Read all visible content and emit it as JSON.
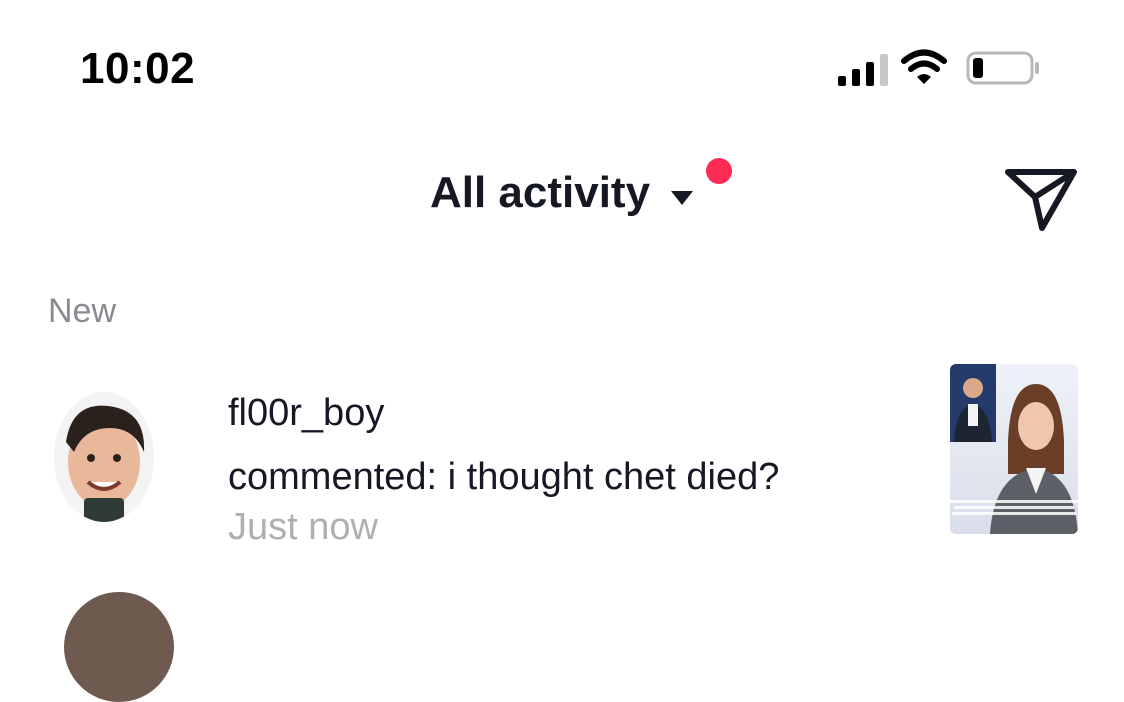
{
  "status_bar": {
    "time": "10:02",
    "signal_bars": 3,
    "battery_level": 0.2
  },
  "header": {
    "title": "All activity",
    "has_unread_dot": true
  },
  "section": {
    "label": "New"
  },
  "notifications": [
    {
      "username": "fl00r_boy",
      "action": "commented: i thought chet died?",
      "time": "Just now"
    }
  ],
  "colors": {
    "accent": "#fe2c55",
    "primary_text": "#161823",
    "secondary_text": "#8a8b91",
    "muted_text": "#aeafb3"
  },
  "icons": [
    "signal-icon",
    "wifi-icon",
    "battery-icon",
    "caret-down-icon",
    "send-icon"
  ]
}
